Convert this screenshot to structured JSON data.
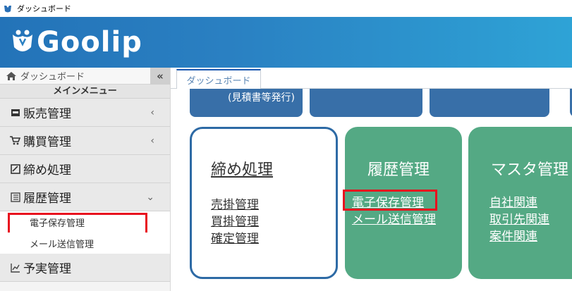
{
  "window": {
    "title": "ダッシュボード"
  },
  "header": {
    "logo_text": "Goolip",
    "colors": {
      "header_start": "#2373b8",
      "header_end": "#2ea3d6"
    }
  },
  "sidebar": {
    "home_label": "ダッシュボード",
    "collapse_glyph": "«",
    "main_menu_label": "メインメニュー",
    "items": [
      {
        "label": "販売管理",
        "icon": "store-icon",
        "chevron": "‹"
      },
      {
        "label": "購買管理",
        "icon": "cart-icon",
        "chevron": "‹"
      },
      {
        "label": "締め処理",
        "icon": "checkbox-icon",
        "chevron": ""
      },
      {
        "label": "履歴管理",
        "icon": "history-icon",
        "chevron": "⌄"
      }
    ],
    "history_subitems": [
      {
        "label": "電子保存管理",
        "highlighted": true
      },
      {
        "label": "メール送信管理",
        "highlighted": false
      }
    ],
    "after_items": [
      {
        "label": "予実管理",
        "icon": "chart-icon"
      }
    ]
  },
  "tabs": [
    {
      "label": "ダッシュボード",
      "active": true
    }
  ],
  "content": {
    "top_button_text": "(見積書等発行)",
    "cards": {
      "closing": {
        "title": "締め処理",
        "links": [
          "売掛管理",
          "買掛管理",
          "確定管理"
        ]
      },
      "history": {
        "title": "履歴管理",
        "links": [
          "電子保存管理",
          "メール送信管理"
        ]
      },
      "master": {
        "title": "マスタ管理",
        "links": [
          "自社関連",
          "取引先関連",
          "案件関連"
        ]
      }
    }
  },
  "colors": {
    "accent_blue": "#2d6aa5",
    "card_green": "#54a984",
    "highlight_red": "#e8101e"
  }
}
